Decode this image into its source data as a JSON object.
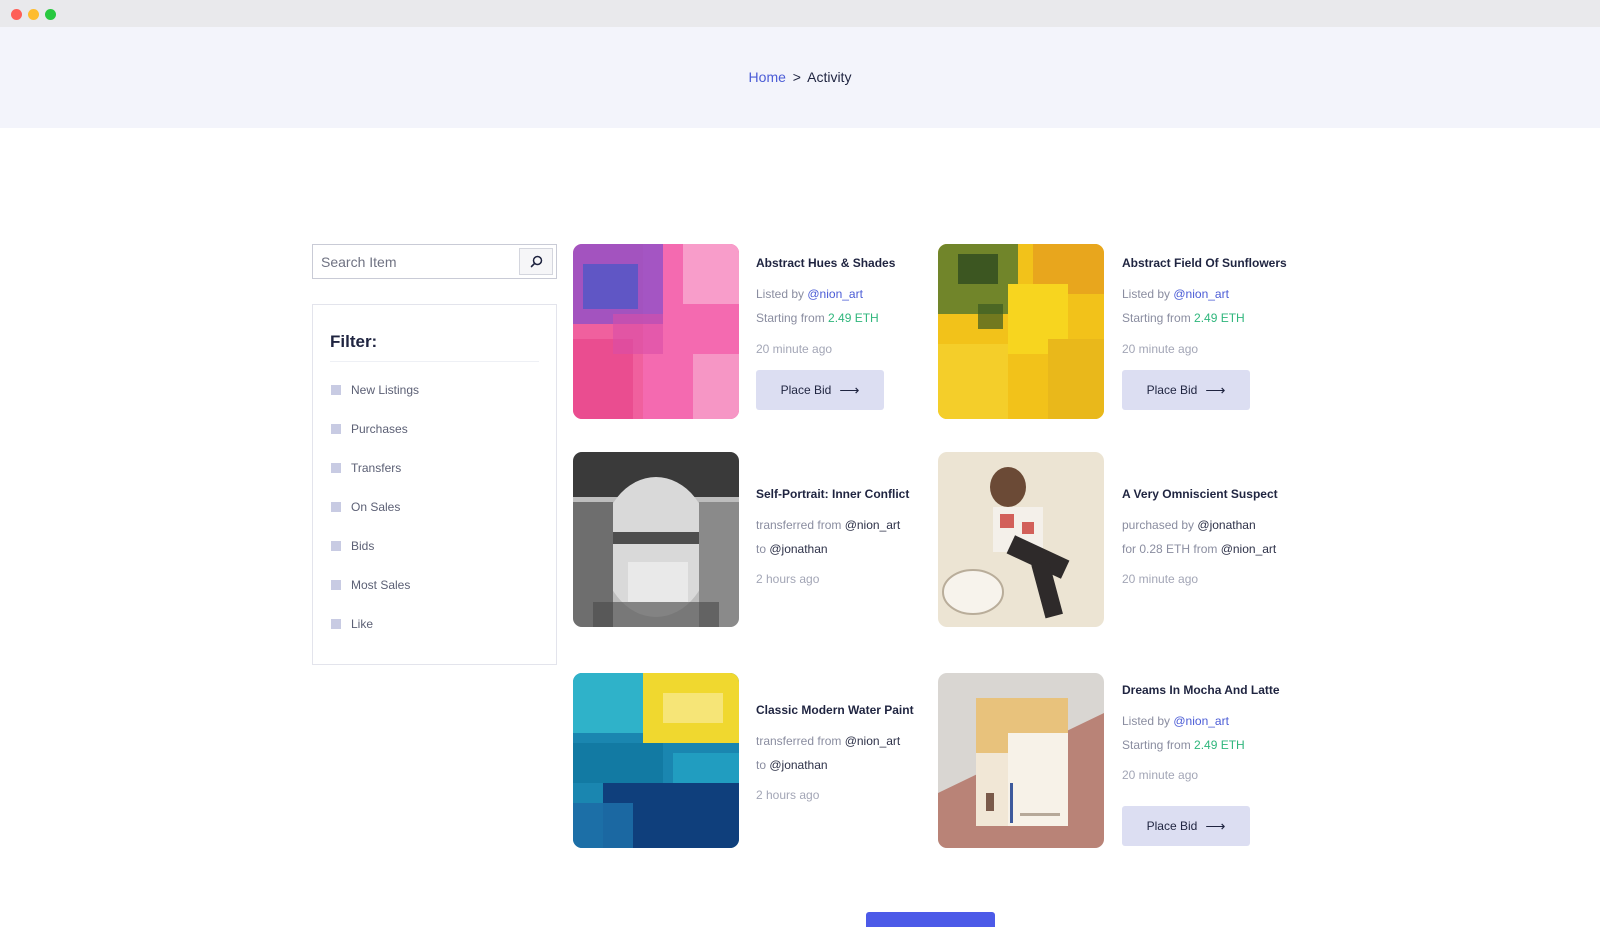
{
  "breadcrumb": {
    "home": "Home",
    "separator": ">",
    "current": "Activity"
  },
  "search": {
    "placeholder": "Search Item",
    "value": "",
    "icon": "search-icon"
  },
  "filter": {
    "title": "Filter:",
    "items": [
      "New Listings",
      "Purchases",
      "Transfers",
      "On Sales",
      "Bids",
      "Most Sales",
      "Like"
    ]
  },
  "cards": [
    {
      "title": "Abstract Hues & Shades",
      "line1": {
        "prefix": "Listed by ",
        "user": "@nion_art"
      },
      "line2": {
        "prefix": "Starting from ",
        "price": "2.49 ETH"
      },
      "time": "20 minute ago",
      "button": "Place Bid"
    },
    {
      "title": "Abstract Field Of Sunflowers",
      "line1": {
        "prefix": "Listed by ",
        "user": "@nion_art"
      },
      "line2": {
        "prefix": "Starting from ",
        "price": "2.49 ETH"
      },
      "time": "20 minute ago",
      "button": "Place Bid"
    },
    {
      "title": "Self-Portrait: Inner Conflict",
      "line1": {
        "prefix": "transferred from ",
        "user": "@nion_art"
      },
      "line2": {
        "prefix": "to ",
        "user": "@jonathan"
      },
      "time": "2 hours ago"
    },
    {
      "title": "A Very Omniscient Suspect",
      "line1": {
        "prefix": "purchased by ",
        "user": "@jonathan"
      },
      "line2": {
        "prefix": "for 0.28 ETH from ",
        "user": "@nion_art"
      },
      "time": "20 minute ago"
    },
    {
      "title": "Classic Modern Water Paint",
      "line1": {
        "prefix": "transferred from ",
        "user": "@nion_art"
      },
      "line2": {
        "prefix": "to ",
        "user": "@jonathan"
      },
      "time": "2 hours ago"
    },
    {
      "title": "Dreams In Mocha And Latte",
      "line1": {
        "prefix": "Listed by ",
        "user": "@nion_art"
      },
      "line2": {
        "prefix": "Starting from ",
        "price": "2.49 ETH"
      },
      "time": "20 minute ago",
      "button": "Place Bid"
    }
  ],
  "colors": {
    "accent": "#4b5cd6",
    "price": "#2fb67c",
    "button_bg": "#dcdef2",
    "load_more": "#4c5ae8"
  }
}
